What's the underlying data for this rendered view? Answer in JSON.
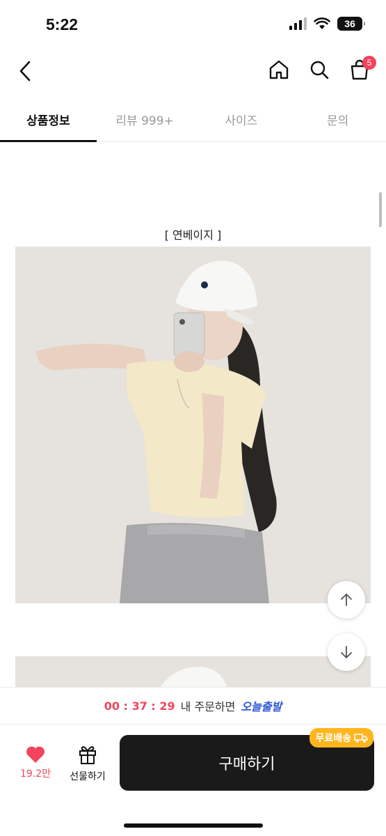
{
  "status_bar": {
    "time": "5:22",
    "battery": "36"
  },
  "nav": {
    "cart_count": "5"
  },
  "tabs": [
    {
      "label": "상품정보",
      "active": true
    },
    {
      "label": "리뷰 999+",
      "active": false
    },
    {
      "label": "사이즈",
      "active": false
    },
    {
      "label": "문의",
      "active": false
    }
  ],
  "content": {
    "image_caption": "[ 연베이지 ]"
  },
  "shipping": {
    "timer": "00 : 37 : 29",
    "order_text": "내 주문하면",
    "today_ship": "오늘출발"
  },
  "bottom": {
    "like_count": "19.2만",
    "gift_label": "선물하기",
    "buy_label": "구매하기",
    "free_shipping": "무료배송"
  },
  "colors": {
    "accent": "#f2445c",
    "ship_blue": "#2f57d8",
    "badge": "#ffb51e",
    "button": "#1a1a1a"
  }
}
